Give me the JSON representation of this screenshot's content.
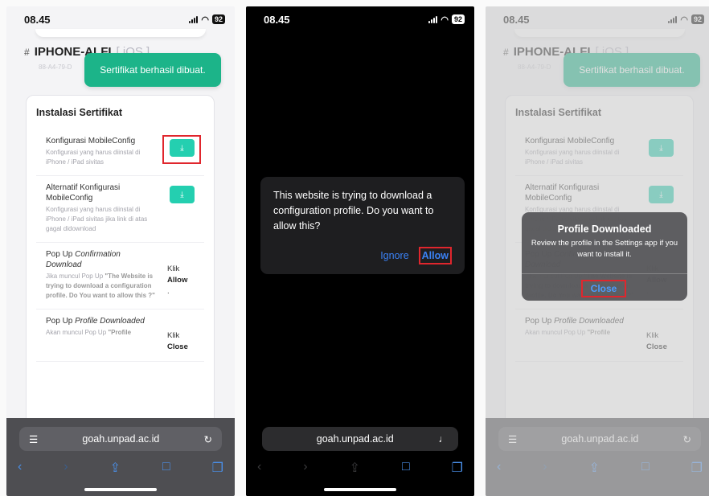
{
  "status": {
    "time": "08.45",
    "battery": "92",
    "wifi_icon": "wifi-icon",
    "signal_icon": "signal-icon"
  },
  "device": {
    "name": "IPHONE-ALFI",
    "os": "[ iOS ]",
    "mac": "88-A4-79-D",
    "hash": "#"
  },
  "toast": {
    "text": "Sertifikat berhasil dibuat."
  },
  "card": {
    "title": "Instalasi Sertifikat",
    "items": [
      {
        "title": "Konfigurasi MobileConfig",
        "desc": "Konfigurasi yang harus diinstal di iPhone / iPad sivitas"
      },
      {
        "title": "Alternatif Konfigurasi MobileConfig",
        "desc": "Konfigurasi yang harus diinstal di iPhone / iPad sivitas jika link di atas gagal didownload"
      },
      {
        "title_plain": "Pop Up",
        "title_italic": "Confirmation Download",
        "desc_plain": "Jika muncul Pop Up",
        "desc_bold": "\"The Website is trying to download a configuration profile. Do You want to allow this ?\"",
        "klik": "Klik",
        "klik_bold": "Allow",
        "klik_suffix": "."
      },
      {
        "title_plain": "Pop Up",
        "title_italic": "Profile Downloaded",
        "desc_plain": "Akan muncul Pop Up",
        "desc_bold": "\"Profile",
        "klik": "Klik",
        "klik_bold": "Close"
      }
    ]
  },
  "browser": {
    "url": "goah.unpad.ac.id",
    "reload_icon": "reload-icon",
    "mic_icon": "mic-icon"
  },
  "alert": {
    "text": "This website is trying to download a configuration profile. Do you want to allow this?",
    "ignore": "Ignore",
    "allow": "Allow"
  },
  "dialog": {
    "title": "Profile Downloaded",
    "message": "Review the profile in the Settings app if you want to install it.",
    "close": "Close"
  },
  "colors": {
    "toast": "#1cb489",
    "button": "#24cfb0",
    "highlight": "#e0262d",
    "link": "#3b82f6"
  }
}
